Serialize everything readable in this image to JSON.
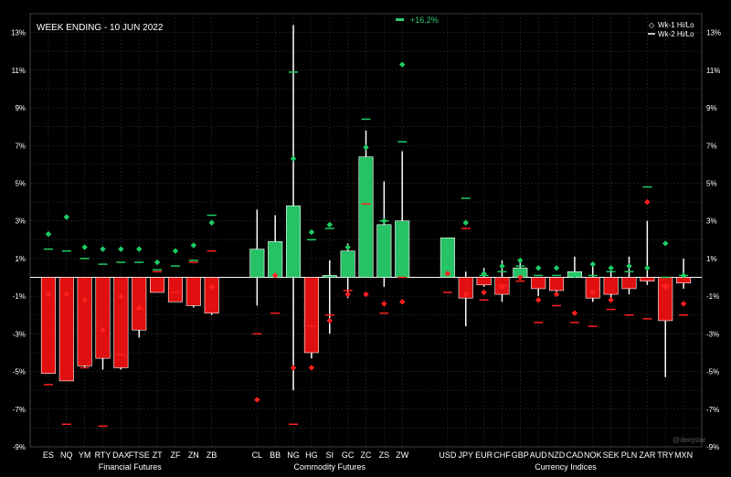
{
  "colors": {
    "background": "#000000",
    "up_bar": "#27c265",
    "down_bar": "#e01010",
    "wk1_up": "#1fce66",
    "wk1_down": "#ff2020",
    "wick": "#ffffff",
    "grid": "#2e2e2e",
    "zero_line": "#ffffff",
    "gain_marker": "#2ecc71",
    "loss_marker": "#ff3030"
  },
  "chart_data": {
    "type": "bar",
    "title": "WEEK ENDING - 10 JUN 2022",
    "ylim": [
      -9,
      14
    ],
    "y_ticks": [
      13,
      11,
      9,
      7,
      5,
      3,
      1,
      -1,
      -3,
      -5,
      -7,
      -9
    ],
    "y_tick_labels": [
      "13%",
      "11%",
      "9%",
      "7%",
      "5%",
      "3%",
      "1%",
      "-1%",
      "-3%",
      "-5%",
      "-7%",
      "-9%"
    ],
    "grid": true,
    "legend": {
      "position": "top-right",
      "entries": [
        {
          "label": "Wk-1 Hi/Lo",
          "marker": "diamond"
        },
        {
          "label": "Wk-2 Hi/Lo",
          "marker": "line"
        }
      ]
    },
    "annotation": "+16.2%",
    "watermark": "@deejstar",
    "groups": [
      {
        "name": "Financial Futures",
        "categories": [
          "ES",
          "NQ",
          "YM",
          "RTY",
          "DAX",
          "FTSE",
          "ZT",
          "ZF",
          "ZN",
          "ZB"
        ]
      },
      {
        "name": "Commodity Futures",
        "categories": [
          "CL",
          "BB",
          "NG",
          "HG",
          "SI",
          "GC",
          "ZC",
          "ZS",
          "ZW"
        ]
      },
      {
        "name": "Currency Indices",
        "categories": [
          "USD",
          "JPY",
          "EUR",
          "CHF",
          "GBP",
          "AUD",
          "NZD",
          "CAD",
          "NOK",
          "SEK",
          "PLN",
          "ZAR",
          "TRY",
          "MXN"
        ]
      }
    ],
    "categories": [
      "ES",
      "NQ",
      "YM",
      "RTY",
      "DAX",
      "FTSE",
      "ZT",
      "ZF",
      "ZN",
      "ZB",
      "CL",
      "BB",
      "NG",
      "HG",
      "SI",
      "GC",
      "ZC",
      "ZS",
      "ZW",
      "USD",
      "JPY",
      "EUR",
      "CHF",
      "GBP",
      "AUD",
      "NZD",
      "CAD",
      "NOK",
      "SEK",
      "PLN",
      "ZAR",
      "TRY",
      "MXN"
    ],
    "weekly_change": [
      -5.1,
      -5.5,
      -4.7,
      -4.3,
      -4.8,
      -2.8,
      -0.8,
      -1.3,
      -1.5,
      -1.9,
      1.5,
      1.9,
      3.8,
      -4.0,
      0.1,
      1.4,
      6.4,
      2.8,
      3.0,
      2.1,
      -1.1,
      -0.4,
      -0.9,
      0.5,
      -0.6,
      -0.7,
      0.3,
      -1.1,
      -0.9,
      -0.6,
      -0.2,
      -2.3,
      -0.3
    ],
    "wick_high": [
      0.0,
      0.0,
      0.0,
      0.0,
      0.0,
      0.0,
      0.0,
      0.0,
      0.0,
      0.0,
      3.6,
      3.3,
      13.4,
      0.0,
      0.9,
      1.8,
      7.8,
      5.1,
      6.7,
      0.0,
      0.3,
      0.5,
      0.9,
      0.8,
      0.0,
      0.0,
      1.1,
      0.6,
      0.5,
      1.1,
      3.0,
      0.0,
      1.0
    ],
    "wick_low": [
      -5.1,
      -5.5,
      -4.8,
      -4.9,
      -4.9,
      -3.2,
      -0.8,
      -1.3,
      -1.6,
      -2.0,
      -1.5,
      0.0,
      -6.0,
      -4.3,
      -3.0,
      -1.1,
      0.0,
      -0.5,
      0.0,
      0.0,
      -2.6,
      -0.5,
      -1.3,
      0.0,
      -1.0,
      -1.0,
      0.0,
      -1.3,
      -1.1,
      -0.9,
      -0.4,
      -5.3,
      -0.6
    ],
    "wk1_high": [
      2.3,
      3.2,
      1.6,
      1.5,
      1.5,
      1.5,
      0.8,
      1.4,
      1.7,
      2.9,
      null,
      null,
      6.3,
      2.4,
      2.8,
      1.6,
      6.9,
      3.0,
      11.3,
      null,
      2.9,
      0.2,
      0.6,
      0.9,
      0.5,
      0.5,
      0.1,
      0.7,
      0.5,
      0.6,
      0.5,
      1.8,
      0.1
    ],
    "wk1_low": [
      -0.9,
      -0.9,
      -1.2,
      -2.8,
      -1.0,
      -1.6,
      null,
      null,
      null,
      -0.5,
      -6.5,
      0.1,
      -4.8,
      -4.8,
      -2.3,
      -0.9,
      -0.9,
      -1.4,
      -1.3,
      0.2,
      -0.9,
      -0.8,
      -0.5,
      0.0,
      -1.2,
      -0.9,
      -1.9,
      -0.8,
      -1.2,
      null,
      4.0,
      -0.5,
      -1.4
    ],
    "wk2_high": [
      1.5,
      1.4,
      1.0,
      0.7,
      0.8,
      0.8,
      0.4,
      0.6,
      0.9,
      3.3,
      null,
      null,
      10.9,
      2.0,
      2.6,
      1.0,
      8.4,
      3.0,
      7.2,
      0.5,
      4.2,
      0.1,
      0.3,
      0.6,
      0.1,
      0.1,
      0.1,
      0.1,
      0.3,
      0.3,
      4.8,
      0.0,
      0.1
    ],
    "wk2_low": [
      -5.7,
      -7.8,
      -4.8,
      -7.9,
      -4.1,
      -1.7,
      0.3,
      -0.8,
      0.8,
      1.4,
      -3.0,
      -1.9,
      -7.8,
      -2.6,
      -2.0,
      -0.7,
      3.9,
      -1.9,
      0.0,
      -0.8,
      2.6,
      -1.2,
      -0.4,
      -0.2,
      -2.4,
      -1.5,
      -2.4,
      -2.6,
      -1.7,
      -2.0,
      -2.2,
      -0.4,
      -2.0
    ],
    "wk1_hi_marker_color": "#1fce66",
    "wk1_lo_marker_color": "#ff2020"
  }
}
